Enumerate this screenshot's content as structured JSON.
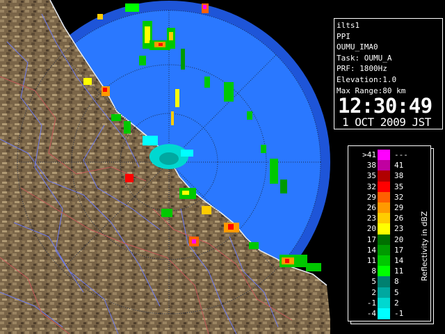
{
  "info": {
    "station": "ilts1",
    "scan_type": "PPI",
    "product": "OUMU_IMA0",
    "task": "Task: OUMU_A",
    "prf": "PRF: 1800Hz",
    "elevation": "Elevation:1.0",
    "max_range": "Max Range:80 km",
    "time": "12:30:49",
    "date": "1 OCT 2009 JST"
  },
  "legend": {
    "title": "Reflectivity in dBZ",
    "rows": [
      {
        "lo": ">41",
        "hi": "---",
        "color": "#ff00ff"
      },
      {
        "lo": "38",
        "hi": "41",
        "color": "#c000a0"
      },
      {
        "lo": "35",
        "hi": "38",
        "color": "#b00000"
      },
      {
        "lo": "32",
        "hi": "35",
        "color": "#ff0000"
      },
      {
        "lo": "29",
        "hi": "32",
        "color": "#ff6000"
      },
      {
        "lo": "26",
        "hi": "29",
        "color": "#ff9a00"
      },
      {
        "lo": "23",
        "hi": "26",
        "color": "#ffcc00"
      },
      {
        "lo": "20",
        "hi": "23",
        "color": "#ffff00"
      },
      {
        "lo": "17",
        "hi": "20",
        "color": "#007000"
      },
      {
        "lo": "14",
        "hi": "17",
        "color": "#009a00"
      },
      {
        "lo": "11",
        "hi": "14",
        "color": "#00c800"
      },
      {
        "lo": "8",
        "hi": "11",
        "color": "#00ff00"
      },
      {
        "lo": "5",
        "hi": "8",
        "color": "#008070"
      },
      {
        "lo": "2",
        "hi": "5",
        "color": "#00a8a0"
      },
      {
        "lo": "-1",
        "hi": "2",
        "color": "#00d8d0"
      },
      {
        "lo": "-4",
        "hi": "-1",
        "color": "#00ffff"
      }
    ]
  },
  "colors": {
    "radar_coverage": "#2a78ff",
    "radar_outer": "#1e55d8",
    "terrain": "#7a6548",
    "coast": "#e8eef8",
    "rivers": "#6f7cf0",
    "boundaries": "#c85a5a"
  }
}
